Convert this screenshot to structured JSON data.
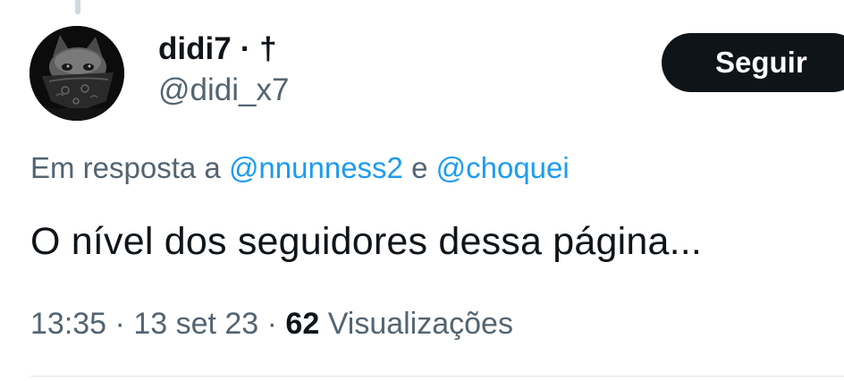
{
  "author": {
    "display_name": "didi7",
    "name_suffix": "· †",
    "handle": "@didi_x7"
  },
  "follow_button": {
    "label": "Seguir"
  },
  "reply_context": {
    "prefix": "Em resposta a ",
    "mention_1": "@nnunness2",
    "connector": " e ",
    "mention_2": "@choquei"
  },
  "tweet": {
    "text": "O nível dos seguidores dessa página..."
  },
  "meta": {
    "time": "13:35",
    "separator_1": " · ",
    "date": "13 set 23",
    "separator_2": " · ",
    "views_count": "62",
    "views_label": " Visualizações"
  },
  "colors": {
    "text_primary": "#0f1419",
    "text_secondary": "#536471",
    "link": "#1d9bf0",
    "button_bg": "#0f1419"
  },
  "icons": {
    "avatar": "masked-cat-avatar"
  }
}
